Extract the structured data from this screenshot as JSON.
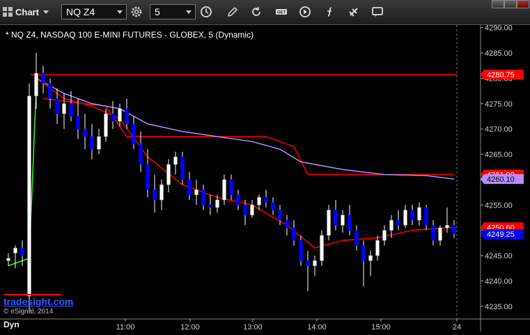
{
  "toolbar": {
    "chart_label": "Chart",
    "symbol_value": "NQ Z4",
    "interval_value": "5",
    "icons": [
      "gear-icon",
      "clock-icon",
      "pencil-icon",
      "refresh-icon",
      "get-icon",
      "play-icon",
      "formula-icon",
      "link-icon",
      "message-icon"
    ]
  },
  "title": "* NQ Z4, NASDAQ 100 E-MINI FUTURES - GLOBEX, 5 (Dynamic)",
  "brand": "tradesight.com",
  "copyright": "© eSignal, 2014",
  "dyn_label": "Dyn",
  "colors": {
    "background": "#000000",
    "up_candle": "#ffffff",
    "down_candle": "#0000ff",
    "red_line": "#ff0000",
    "purple_line": "#b58cff",
    "green_line": "#33ff33",
    "price_tag": "#ff0000",
    "current_tag": "#0000ff"
  },
  "chart_data": {
    "type": "candlestick",
    "yticks": [
      4235,
      4240,
      4245,
      4250,
      4255,
      4260,
      4265,
      4270,
      4275,
      4280,
      4285,
      4290
    ],
    "ytick_labels": [
      "4235.00",
      "4240.00",
      "4245.00",
      "4250.00",
      "4255.00",
      "4260.00",
      "4265.00",
      "4270.00",
      "4275.00",
      "4280.00",
      "4285.00",
      "4290.00"
    ],
    "ylim": [
      4232.5,
      4290.5
    ],
    "x_labels": [
      "11:00",
      "12:00",
      "13:00",
      "14:00",
      "15:00",
      "24"
    ],
    "price_tags": [
      {
        "label": "4280.75",
        "value": 4280.75,
        "color": "#ff0000"
      },
      {
        "label": "4261.00",
        "value": 4261.0,
        "color": "#ff0000"
      },
      {
        "label": "4260.10",
        "value": 4260.1,
        "color": "#b58cff"
      },
      {
        "label": "4250.60",
        "value": 4250.6,
        "color": "#ff0000"
      },
      {
        "label": "4249.25",
        "value": 4249.25,
        "color": "#0000ff"
      }
    ],
    "candles": [
      [
        4244.0,
        4245.5,
        4243.0,
        4244.5
      ],
      [
        4245.5,
        4247.0,
        4242.5,
        4246.5
      ],
      [
        4246.5,
        4248.0,
        4243.0,
        4245.0
      ],
      [
        4237.0,
        4279.0,
        4234.0,
        4276.5
      ],
      [
        4276.5,
        4285.0,
        4274.0,
        4281.0
      ],
      [
        4281.0,
        4282.5,
        4277.0,
        4279.0
      ],
      [
        4279.0,
        4280.0,
        4274.0,
        4276.0
      ],
      [
        4276.0,
        4278.0,
        4271.0,
        4273.0
      ],
      [
        4273.0,
        4277.0,
        4270.0,
        4275.0
      ],
      [
        4275.0,
        4277.5,
        4271.5,
        4272.5
      ],
      [
        4272.5,
        4276.0,
        4268.0,
        4270.0
      ],
      [
        4270.0,
        4273.0,
        4266.0,
        4268.5
      ],
      [
        4268.5,
        4271.0,
        4264.0,
        4266.0
      ],
      [
        4266.0,
        4270.0,
        4265.0,
        4268.5
      ],
      [
        4268.5,
        4274.0,
        4267.5,
        4273.0
      ],
      [
        4273.0,
        4275.5,
        4270.0,
        4271.5
      ],
      [
        4271.5,
        4275.0,
        4270.5,
        4274.0
      ],
      [
        4274.0,
        4276.0,
        4270.0,
        4271.0
      ],
      [
        4271.0,
        4272.5,
        4266.0,
        4267.0
      ],
      [
        4267.0,
        4269.5,
        4261.5,
        4263.0
      ],
      [
        4263.0,
        4266.0,
        4256.5,
        4258.0
      ],
      [
        4258.0,
        4261.0,
        4253.5,
        4256.0
      ],
      [
        4256.0,
        4260.0,
        4254.0,
        4259.0
      ],
      [
        4259.0,
        4264.0,
        4257.5,
        4263.0
      ],
      [
        4263.0,
        4265.5,
        4261.0,
        4264.5
      ],
      [
        4264.5,
        4265.5,
        4259.0,
        4260.0
      ],
      [
        4260.0,
        4261.5,
        4256.0,
        4257.0
      ],
      [
        4257.0,
        4260.0,
        4255.0,
        4258.0
      ],
      [
        4258.0,
        4259.0,
        4254.0,
        4255.0
      ],
      [
        4255.0,
        4257.0,
        4253.0,
        4254.5
      ],
      [
        4254.5,
        4257.0,
        4253.5,
        4256.0
      ],
      [
        4256.0,
        4261.0,
        4255.0,
        4260.0
      ],
      [
        4260.0,
        4261.0,
        4256.0,
        4257.0
      ],
      [
        4257.0,
        4258.0,
        4254.0,
        4255.0
      ],
      [
        4255.0,
        4256.0,
        4251.0,
        4253.0
      ],
      [
        4253.0,
        4256.0,
        4252.5,
        4255.0
      ],
      [
        4255.0,
        4257.0,
        4254.0,
        4256.5
      ],
      [
        4256.5,
        4258.0,
        4254.5,
        4255.5
      ],
      [
        4255.5,
        4256.5,
        4253.0,
        4254.0
      ],
      [
        4254.0,
        4255.0,
        4251.0,
        4252.0
      ],
      [
        4252.0,
        4253.0,
        4249.0,
        4250.5
      ],
      [
        4250.5,
        4252.0,
        4247.0,
        4248.0
      ],
      [
        4248.0,
        4249.0,
        4243.0,
        4244.0
      ],
      [
        4244.0,
        4246.0,
        4238.0,
        4243.0
      ],
      [
        4243.0,
        4245.0,
        4241.0,
        4244.0
      ],
      [
        4244.0,
        4250.0,
        4243.0,
        4249.0
      ],
      [
        4249.0,
        4255.0,
        4248.0,
        4254.0
      ],
      [
        4254.0,
        4256.0,
        4250.0,
        4251.0
      ],
      [
        4251.0,
        4254.0,
        4249.5,
        4253.0
      ],
      [
        4253.0,
        4255.0,
        4249.0,
        4250.0
      ],
      [
        4250.0,
        4251.0,
        4246.0,
        4247.0
      ],
      [
        4247.0,
        4248.0,
        4239.0,
        4244.0
      ],
      [
        4244.0,
        4246.0,
        4241.0,
        4245.0
      ],
      [
        4245.0,
        4249.0,
        4244.0,
        4248.0
      ],
      [
        4248.0,
        4251.0,
        4247.0,
        4250.0
      ],
      [
        4250.0,
        4253.0,
        4248.5,
        4252.0
      ],
      [
        4252.0,
        4254.0,
        4250.0,
        4251.0
      ],
      [
        4251.0,
        4255.0,
        4250.5,
        4254.0
      ],
      [
        4254.0,
        4255.0,
        4251.0,
        4252.0
      ],
      [
        4252.0,
        4255.5,
        4251.0,
        4254.5
      ],
      [
        4254.5,
        4255.0,
        4250.0,
        4251.0
      ],
      [
        4251.0,
        4252.0,
        4247.0,
        4248.0
      ],
      [
        4248.0,
        4251.0,
        4247.0,
        4250.5
      ],
      [
        4250.5,
        4254.5,
        4249.5,
        4251.0
      ],
      [
        4251.0,
        4252.0,
        4248.5,
        4249.25
      ]
    ],
    "red_ma": [
      [
        4,
        4280
      ],
      [
        8,
        4276
      ],
      [
        12,
        4274.5
      ],
      [
        16,
        4272
      ],
      [
        20,
        4264.5
      ],
      [
        25,
        4259
      ],
      [
        30,
        4256.5
      ],
      [
        35,
        4255
      ],
      [
        40,
        4251
      ],
      [
        44,
        4246.5
      ],
      [
        48,
        4248
      ],
      [
        53,
        4248.5
      ],
      [
        58,
        4250
      ],
      [
        63,
        4250.5
      ],
      [
        64,
        4250.6
      ]
    ],
    "purple_ma": [
      [
        4,
        4280
      ],
      [
        8,
        4277
      ],
      [
        12,
        4275
      ],
      [
        16,
        4274
      ],
      [
        20,
        4271
      ],
      [
        25,
        4269.5
      ],
      [
        30,
        4268.5
      ],
      [
        35,
        4267.5
      ],
      [
        39,
        4266
      ],
      [
        42,
        4263.5
      ],
      [
        48,
        4262
      ],
      [
        54,
        4261
      ],
      [
        60,
        4260.8
      ],
      [
        64,
        4260.1
      ]
    ],
    "red_hline_1": 4280.75,
    "red_step": [
      [
        5,
        4276
      ],
      [
        14,
        4274.5
      ],
      [
        17,
        4268.5
      ],
      [
        37,
        4268.5
      ],
      [
        41,
        4266.5
      ],
      [
        43,
        4261
      ],
      [
        64,
        4261
      ]
    ],
    "green_ma": [
      [
        0,
        4243
      ],
      [
        3,
        4244.5
      ],
      [
        4,
        4278
      ]
    ]
  }
}
